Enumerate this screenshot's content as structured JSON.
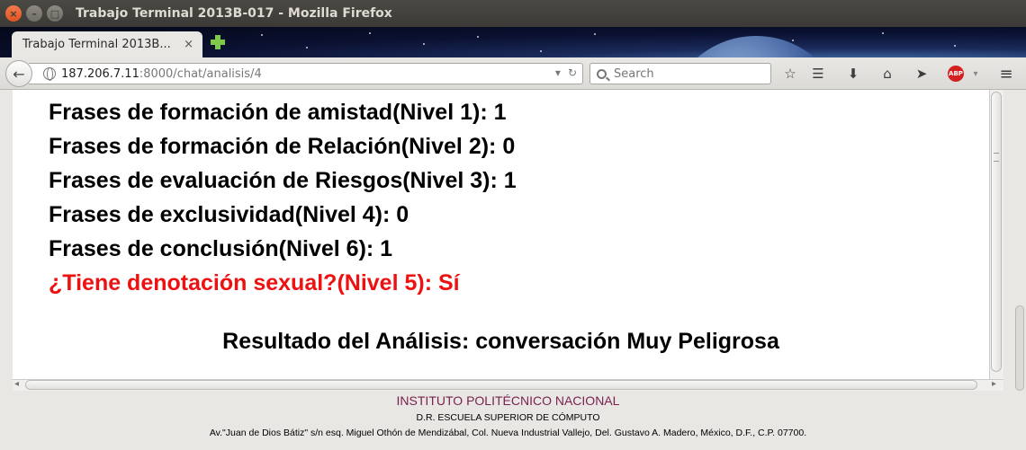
{
  "window": {
    "title": "Trabajo Terminal 2013B-017 - Mozilla Firefox",
    "close_glyph": "×",
    "minimize_glyph": "–",
    "maximize_glyph": "□"
  },
  "tabs": [
    {
      "label": "Trabajo Terminal 2013B...",
      "close_glyph": "×"
    }
  ],
  "toolbar": {
    "url_host": "187.206.7.11",
    "url_rest": ":8000/chat/analisis/4",
    "search_placeholder": "Search",
    "icons": [
      "back-icon",
      "globe-icon",
      "dropdown-icon",
      "reload-icon",
      "search-icon",
      "bookmark-star-icon",
      "reading-list-icon",
      "download-icon",
      "home-icon",
      "send-icon",
      "adblock-icon",
      "menu-icon"
    ],
    "abp_label": "ABP"
  },
  "analysis": {
    "lines": [
      "Frases de formación de amistad(Nivel 1): 1",
      "Frases de formación de Relación(Nivel 2): 0",
      "Frases de evaluación de Riesgos(Nivel 3): 1",
      "Frases de exclusividad(Nivel 4): 0",
      "Frases de conclusión(Nivel 6): 1"
    ],
    "sexual_line": "¿Tiene denotación sexual?(Nivel 5): Sí",
    "sexual_color": "#ee1111",
    "result": "Resultado del Análisis: conversación Muy Peligrosa"
  },
  "footer": {
    "institution": "INSTITUTO POLITÉCNICO NACIONAL",
    "school": "D.R. ESCUELA SUPERIOR DE CÓMPUTO",
    "address": "Av.\"Juan de Dios Bátiz\" s/n esq. Miguel Othón de Mendizábal, Col. Nueva Industrial Vallejo, Del. Gustavo A. Madero, México, D.F., C.P. 07700.",
    "institution_color": "#7a1f4f"
  }
}
